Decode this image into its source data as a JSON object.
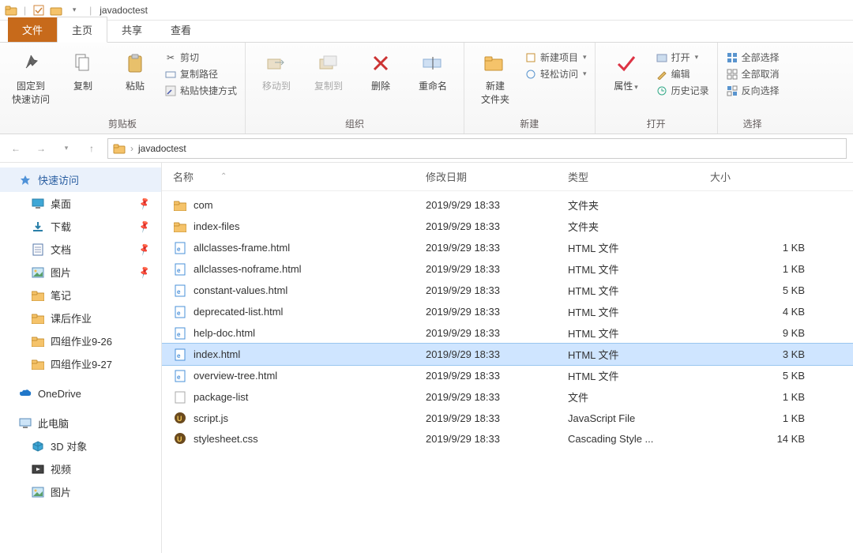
{
  "title": "javadoctest",
  "tabs": {
    "file": "文件",
    "home": "主页",
    "share": "共享",
    "view": "查看"
  },
  "ribbon": {
    "clipboard": {
      "label": "剪贴板",
      "pin": "固定到\n快速访问",
      "copy": "复制",
      "paste": "粘贴",
      "cut": "剪切",
      "copypath": "复制路径",
      "pasteshortcut": "粘贴快捷方式"
    },
    "organize": {
      "label": "组织",
      "moveto": "移动到",
      "copyto": "复制到",
      "delete": "删除",
      "rename": "重命名"
    },
    "new": {
      "label": "新建",
      "newfolder": "新建\n文件夹",
      "newitem": "新建项目",
      "easyaccess": "轻松访问"
    },
    "open": {
      "label": "打开",
      "properties": "属性",
      "open": "打开",
      "edit": "编辑",
      "history": "历史记录"
    },
    "select": {
      "label": "选择",
      "selectall": "全部选择",
      "selectnone": "全部取消",
      "invert": "反向选择"
    }
  },
  "address": {
    "crumb": "javadoctest"
  },
  "sidebar": {
    "quick": "快速访问",
    "items": [
      {
        "icon": "desktop",
        "label": "桌面",
        "pin": true
      },
      {
        "icon": "download",
        "label": "下载",
        "pin": true
      },
      {
        "icon": "doc",
        "label": "文档",
        "pin": true
      },
      {
        "icon": "pic",
        "label": "图片",
        "pin": true
      },
      {
        "icon": "folder",
        "label": "笔记",
        "pin": false
      },
      {
        "icon": "folder",
        "label": "课后作业",
        "pin": false
      },
      {
        "icon": "folder",
        "label": "四组作业9-26",
        "pin": false
      },
      {
        "icon": "folder",
        "label": "四组作业9-27",
        "pin": false
      }
    ],
    "onedrive": "OneDrive",
    "thispc": "此电脑",
    "pcitems": [
      {
        "icon": "3d",
        "label": "3D 对象"
      },
      {
        "icon": "video",
        "label": "视频"
      },
      {
        "icon": "pic",
        "label": "图片"
      }
    ]
  },
  "columns": {
    "name": "名称",
    "date": "修改日期",
    "type": "类型",
    "size": "大小"
  },
  "rows": [
    {
      "icon": "folder",
      "name": "com",
      "date": "2019/9/29 18:33",
      "type": "文件夹",
      "size": ""
    },
    {
      "icon": "folder",
      "name": "index-files",
      "date": "2019/9/29 18:33",
      "type": "文件夹",
      "size": ""
    },
    {
      "icon": "html",
      "name": "allclasses-frame.html",
      "date": "2019/9/29 18:33",
      "type": "HTML 文件",
      "size": "1 KB"
    },
    {
      "icon": "html",
      "name": "allclasses-noframe.html",
      "date": "2019/9/29 18:33",
      "type": "HTML 文件",
      "size": "1 KB"
    },
    {
      "icon": "html",
      "name": "constant-values.html",
      "date": "2019/9/29 18:33",
      "type": "HTML 文件",
      "size": "5 KB"
    },
    {
      "icon": "html",
      "name": "deprecated-list.html",
      "date": "2019/9/29 18:33",
      "type": "HTML 文件",
      "size": "4 KB"
    },
    {
      "icon": "html",
      "name": "help-doc.html",
      "date": "2019/9/29 18:33",
      "type": "HTML 文件",
      "size": "9 KB"
    },
    {
      "icon": "html",
      "name": "index.html",
      "date": "2019/9/29 18:33",
      "type": "HTML 文件",
      "size": "3 KB",
      "selected": true
    },
    {
      "icon": "html",
      "name": "overview-tree.html",
      "date": "2019/9/29 18:33",
      "type": "HTML 文件",
      "size": "5 KB"
    },
    {
      "icon": "file",
      "name": "package-list",
      "date": "2019/9/29 18:33",
      "type": "文件",
      "size": "1 KB"
    },
    {
      "icon": "js",
      "name": "script.js",
      "date": "2019/9/29 18:33",
      "type": "JavaScript File",
      "size": "1 KB"
    },
    {
      "icon": "css",
      "name": "stylesheet.css",
      "date": "2019/9/29 18:33",
      "type": "Cascading Style ...",
      "size": "14 KB"
    }
  ]
}
